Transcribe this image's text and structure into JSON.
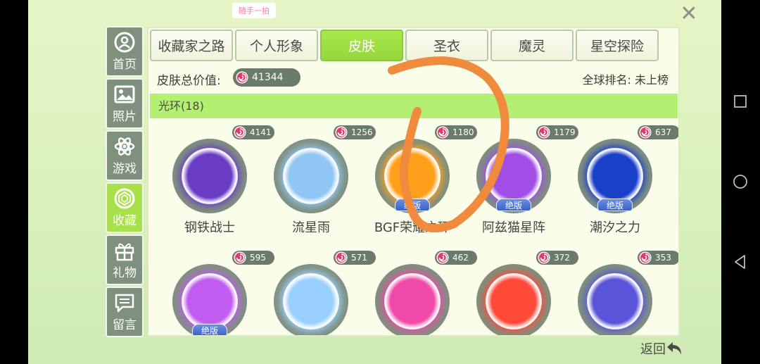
{
  "window": {
    "logo_text": "随手一拍"
  },
  "sidebar": {
    "items": [
      {
        "label": "首页",
        "icon": "home-icon",
        "active": false
      },
      {
        "label": "照片",
        "icon": "photo-icon",
        "active": false
      },
      {
        "label": "游戏",
        "icon": "atom-icon",
        "active": false
      },
      {
        "label": "收藏",
        "icon": "gem-icon",
        "active": true
      },
      {
        "label": "礼物",
        "icon": "gift-icon",
        "active": false
      },
      {
        "label": "留言",
        "icon": "message-icon",
        "active": false
      }
    ]
  },
  "tabs": [
    {
      "label": "收藏家之路",
      "active": false
    },
    {
      "label": "个人形象",
      "active": false
    },
    {
      "label": "皮肤",
      "active": true
    },
    {
      "label": "圣衣",
      "active": false
    },
    {
      "label": "魔灵",
      "active": false
    },
    {
      "label": "星空探险",
      "active": false
    }
  ],
  "summary": {
    "total_label": "皮肤总价值:",
    "total_value": "41344",
    "rank_text": "全球排名: 未上榜"
  },
  "section": {
    "title": "光环(18)"
  },
  "items": [
    {
      "name": "钢铁战士",
      "price": "4141",
      "limited": false,
      "color": "#6a3cc4"
    },
    {
      "name": "流星雨",
      "price": "1256",
      "limited": false,
      "color": "#8fc6f4"
    },
    {
      "name": "BGF荣耀之环",
      "price": "1180",
      "limited": true,
      "color": "#ff9f1a"
    },
    {
      "name": "阿兹猫星阵",
      "price": "1179",
      "limited": true,
      "color": "#a04ee6"
    },
    {
      "name": "潮汐之力",
      "price": "637",
      "limited": true,
      "color": "#1a3fc8"
    },
    {
      "name": "",
      "price": "595",
      "limited": true,
      "color": "#c05cf0"
    },
    {
      "name": "",
      "price": "571",
      "limited": false,
      "color": "#9ad0ff"
    },
    {
      "name": "",
      "price": "462",
      "limited": false,
      "color": "#f04aa8"
    },
    {
      "name": "",
      "price": "372",
      "limited": false,
      "color": "#ff4a3a"
    },
    {
      "name": "",
      "price": "353",
      "limited": false,
      "color": "#5a54d8"
    }
  ],
  "badge_text": "绝版",
  "back_label": "返回",
  "colors": {
    "accent": "#a8e04a",
    "panel": "#fafde9",
    "scribble": "#f08a3c"
  }
}
